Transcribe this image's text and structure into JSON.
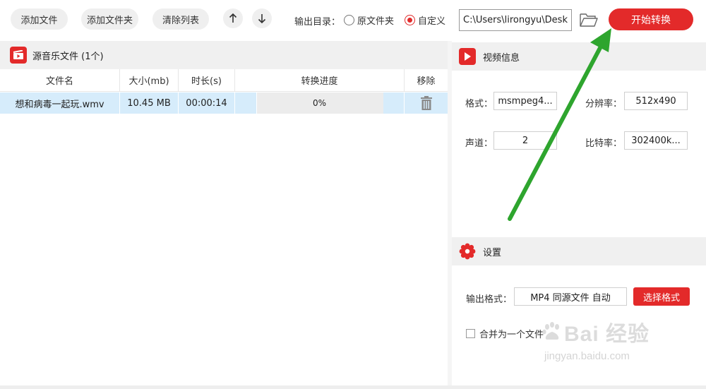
{
  "toolbar": {
    "add_file": "添加文件",
    "add_folder": "添加文件夹",
    "clear_list": "清除列表",
    "move_up_icon": "arrow-up",
    "move_down_icon": "arrow-down",
    "output_dir_label": "输出目录：",
    "radio_original": "原文件夹",
    "radio_custom": "自定义",
    "radio_selected": "custom",
    "output_path": "C:\\Users\\lirongyu\\Desk",
    "start_button": "开始转换"
  },
  "file_panel": {
    "title": "源音乐文件 (1个)",
    "columns": [
      "文件名",
      "大小(mb)",
      "时长(s)",
      "转换进度",
      "移除"
    ],
    "rows": [
      {
        "name": "想和病毒一起玩.wmv",
        "size": "10.45 MB",
        "duration": "00:00:14",
        "progress_text": "0%",
        "progress": 0
      }
    ]
  },
  "video_info": {
    "title": "视频信息",
    "format_label": "格式：",
    "format_value": "msmpeg4...",
    "resolution_label": "分辨率：",
    "resolution_value": "512x490",
    "channels_label": "声道：",
    "channels_value": "2",
    "bitrate_label": "比特率：",
    "bitrate_value": "302400k..."
  },
  "settings": {
    "title": "设置",
    "output_format_label": "输出格式：",
    "output_format_value": "MP4 同源文件 自动",
    "select_format_button": "选择格式",
    "merge_label": "合并为一个文件",
    "merge_checked": false
  },
  "watermark": {
    "brand": "Bai 经验",
    "url": "jingyan.baidu.com"
  },
  "colors": {
    "accent_red": "#e32a2a",
    "selected_row": "#d6ecfb",
    "annotation_arrow": "#2ea52e"
  }
}
